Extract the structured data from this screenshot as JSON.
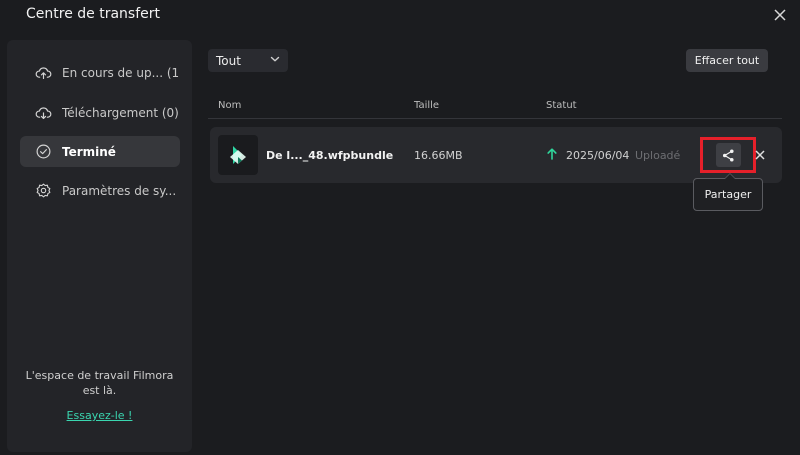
{
  "window": {
    "title": "Centre de transfert"
  },
  "sidebar": {
    "items": [
      {
        "label": "En cours de up... (1)",
        "icon": "cloud-upload-icon",
        "active": false
      },
      {
        "label": "Téléchargement (0)",
        "icon": "cloud-download-icon",
        "active": false
      },
      {
        "label": "Terminé",
        "icon": "check-circle-icon",
        "active": true
      },
      {
        "label": "Paramètres de sy...",
        "icon": "gear-icon",
        "active": false
      }
    ],
    "promo_text": "L'espace de travail Filmora est là.",
    "promo_link": "Essayez-le !"
  },
  "toolbar": {
    "filter_value": "Tout",
    "clear_label": "Effacer tout"
  },
  "table": {
    "columns": [
      "Nom",
      "Taille",
      "Statut"
    ],
    "rows": [
      {
        "name": "De l..._48.wfpbundle",
        "size": "16.66MB",
        "date": "2025/06/04",
        "status": "Uploadé"
      }
    ]
  },
  "tooltip": {
    "share": "Partager"
  },
  "colors": {
    "accent": "#3ad6b0",
    "upload_arrow": "#2fd49a",
    "highlight": "#e5202a",
    "background": "#1b1c1f"
  }
}
